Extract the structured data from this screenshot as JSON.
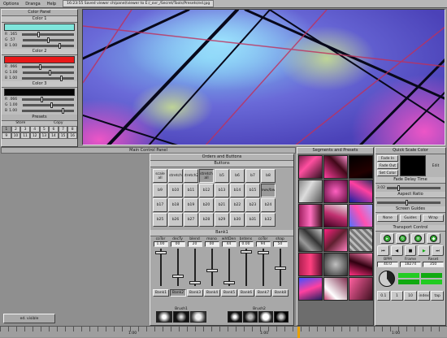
{
  "menu": {
    "items": [
      "Options",
      "Dranga",
      "Help"
    ],
    "title": "16:23:55  Saved viewer ch/panel/viewer to E:/_ovr_/Secret/Tools/Presets/ed.jpg"
  },
  "color_panel": {
    "title": "Color Panel",
    "colors": [
      {
        "title": "Color 1",
        "swatch": "#7fe6dc",
        "rows": [
          {
            "label": "R",
            "value": ".165"
          },
          {
            "label": "G",
            ".value": "",
            "value": ".57"
          },
          {
            "label": "B",
            "value": "1.00"
          }
        ]
      },
      {
        "title": "Color 2",
        "swatch": "#e81818",
        "rows": [
          {
            "label": "R",
            "value": ".066"
          },
          {
            "label": "G",
            "value": "1.00"
          },
          {
            "label": "B",
            "value": "1.00"
          }
        ]
      },
      {
        "title": "Color 3",
        "swatch": "#050505",
        "rows": [
          {
            "label": "R",
            "value": ".066"
          },
          {
            "label": "G",
            "value": "1.00"
          },
          {
            "label": "B",
            "value": "1.00"
          }
        ]
      }
    ],
    "presets_title": "Presets",
    "presets_store": "Store",
    "presets_copy": "Copy",
    "preset_numbers": [
      "1",
      "2",
      "3",
      "4",
      "5",
      "6",
      "7",
      "8",
      "9",
      "10",
      "11",
      "12",
      "13",
      "14",
      "15",
      "16"
    ]
  },
  "main_panel": {
    "title": "Main Control Panel"
  },
  "orders": {
    "title": "Orders and Buttons",
    "buttons_title": "Buttons",
    "buttons": [
      [
        "scale all",
        "stretch",
        "stretch2",
        "stretch all",
        "b5",
        "b6",
        "b7",
        "b8"
      ],
      [
        "b9",
        "b10",
        "b11",
        "b12",
        "b13",
        "b14",
        "b15",
        "ewv/bw"
      ],
      [
        "b17",
        "b18",
        "b19",
        "b20",
        "b21",
        "b22",
        "b23",
        "b24"
      ],
      [
        "b25",
        "b26",
        "b27",
        "b28",
        "b29",
        "b30",
        "b31",
        "b32"
      ]
    ],
    "bank_title": "Bank1",
    "fader_labels": [
      "coTor",
      "decTy",
      "blend",
      "mono",
      "whtDen",
      "bntens",
      "coTor",
      "shap"
    ],
    "fader_values": [
      "1.00",
      "00",
      "20",
      "00",
      "44",
      "0.00",
      "94",
      "50"
    ],
    "fader_levels": [
      0.92,
      0.25,
      0.05,
      0.4,
      0.05,
      0.95,
      0.92,
      0.48
    ],
    "banks": [
      "Bank1",
      "Bank2",
      "Bank3",
      "Bank4",
      "Bank5",
      "Bank6",
      "Bank7",
      "Bank8"
    ],
    "active_bank": 1,
    "brush1_label": "Brush1",
    "brush2_label": "Brush2"
  },
  "segments": {
    "title": "Segments and Presets"
  },
  "quickinfo": {
    "title": "Quick Scale Color",
    "fade_in": "Fade In",
    "fade_out": "Fade Out",
    "set_color": "Set Color",
    "edit": "Edit",
    "fade_secs_title": "Fade Delay Time",
    "fade_secs_value": "3.02",
    "aspect_title": "Aspect Ratio",
    "screen_title": "Screen Guides",
    "none": "None",
    "guides": "Guides",
    "wrap": "Wrap"
  },
  "transport": {
    "title": "Transport Control",
    "bpm_label": "BPM",
    "frame_label": "Frame",
    "reset_label": "Reset",
    "bpm": "40.0",
    "frame": "18274",
    "reset": "350",
    "bottom_buttons": [
      "0.1",
      "1",
      "10",
      "index",
      "tap"
    ]
  },
  "status": {
    "viewer_btn": "ed. visible"
  },
  "timeline": {
    "labels": [
      "1:00",
      "1:00",
      "1:00"
    ]
  }
}
